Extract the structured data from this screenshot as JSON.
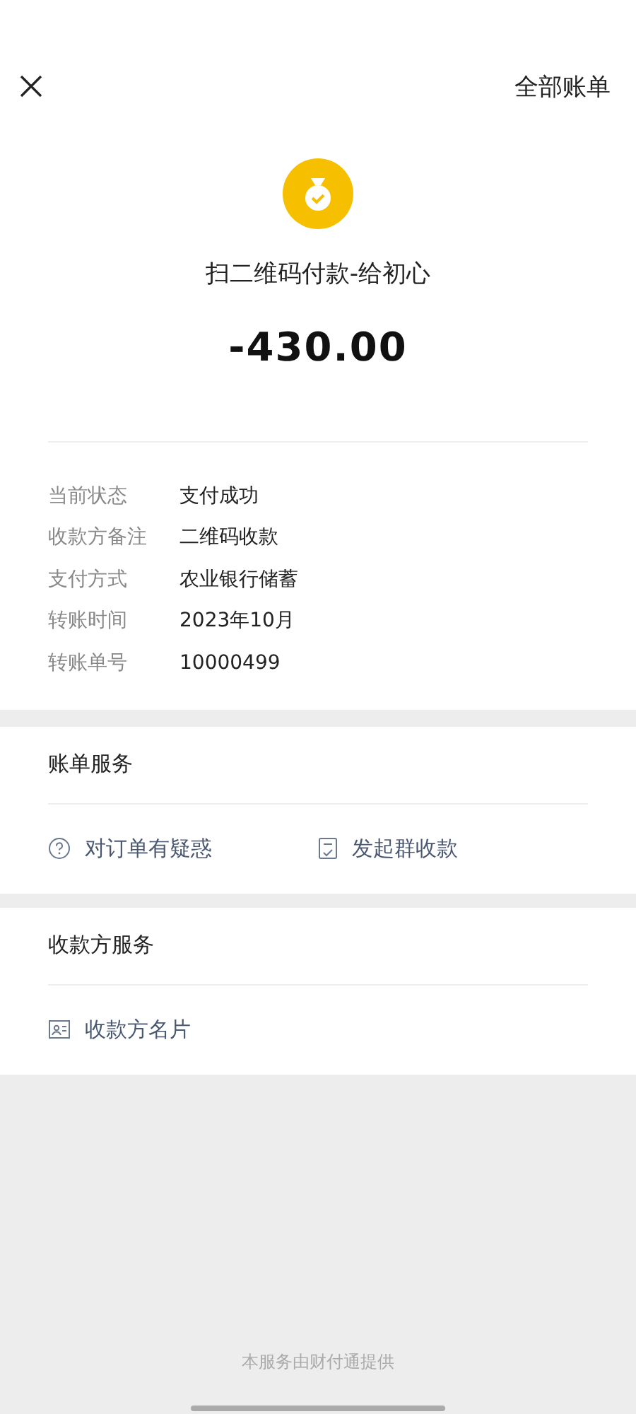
{
  "header": {
    "all_bills": "全部账单"
  },
  "payment": {
    "title": "扫二维码付款-给初心",
    "amount": "-430.00"
  },
  "details": [
    {
      "label": "当前状态",
      "value": "支付成功"
    },
    {
      "label": "收款方备注",
      "value": "二维码收款"
    },
    {
      "label": "支付方式",
      "value": "农业银行储蓄"
    },
    {
      "label": "转账时间",
      "value": "2023年10月"
    },
    {
      "label": "转账单号",
      "value": "10000499"
    }
  ],
  "bill_services": {
    "title": "账单服务",
    "actions": [
      {
        "kind": "question",
        "label": "对订单有疑惑"
      },
      {
        "kind": "receipt",
        "label": "发起群收款"
      }
    ]
  },
  "payee_services": {
    "title": "收款方服务",
    "actions": [
      {
        "kind": "card",
        "label": "收款方名片"
      }
    ]
  },
  "footer": "本服务由财付通提供"
}
